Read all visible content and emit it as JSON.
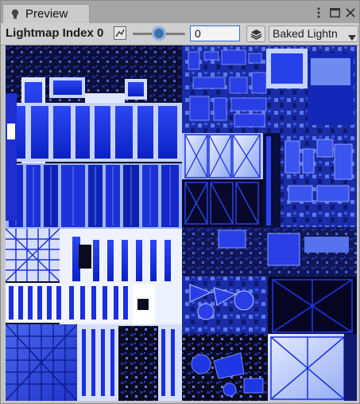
{
  "tab": {
    "title": "Preview",
    "icon": "lightbulb-icon"
  },
  "window_controls": {
    "menu_icon": "kebab-menu-icon",
    "maximize_icon": "maximize-icon",
    "close_icon": "close-icon"
  },
  "toolbar": {
    "lightmap_label": "Lightmap Index 0",
    "index_value": "0",
    "slider_level": 0.5,
    "mode_value": "Baked Lightn",
    "mode_icon": "layers-icon",
    "toggle_icon": "chart-toggle-icon"
  },
  "preview": {
    "image_icon": "lightmap-texture"
  },
  "colors": {
    "accent_blue": "#1a2fe0",
    "panel": "#c2c2c2",
    "tabbar": "#a5a5a5"
  }
}
